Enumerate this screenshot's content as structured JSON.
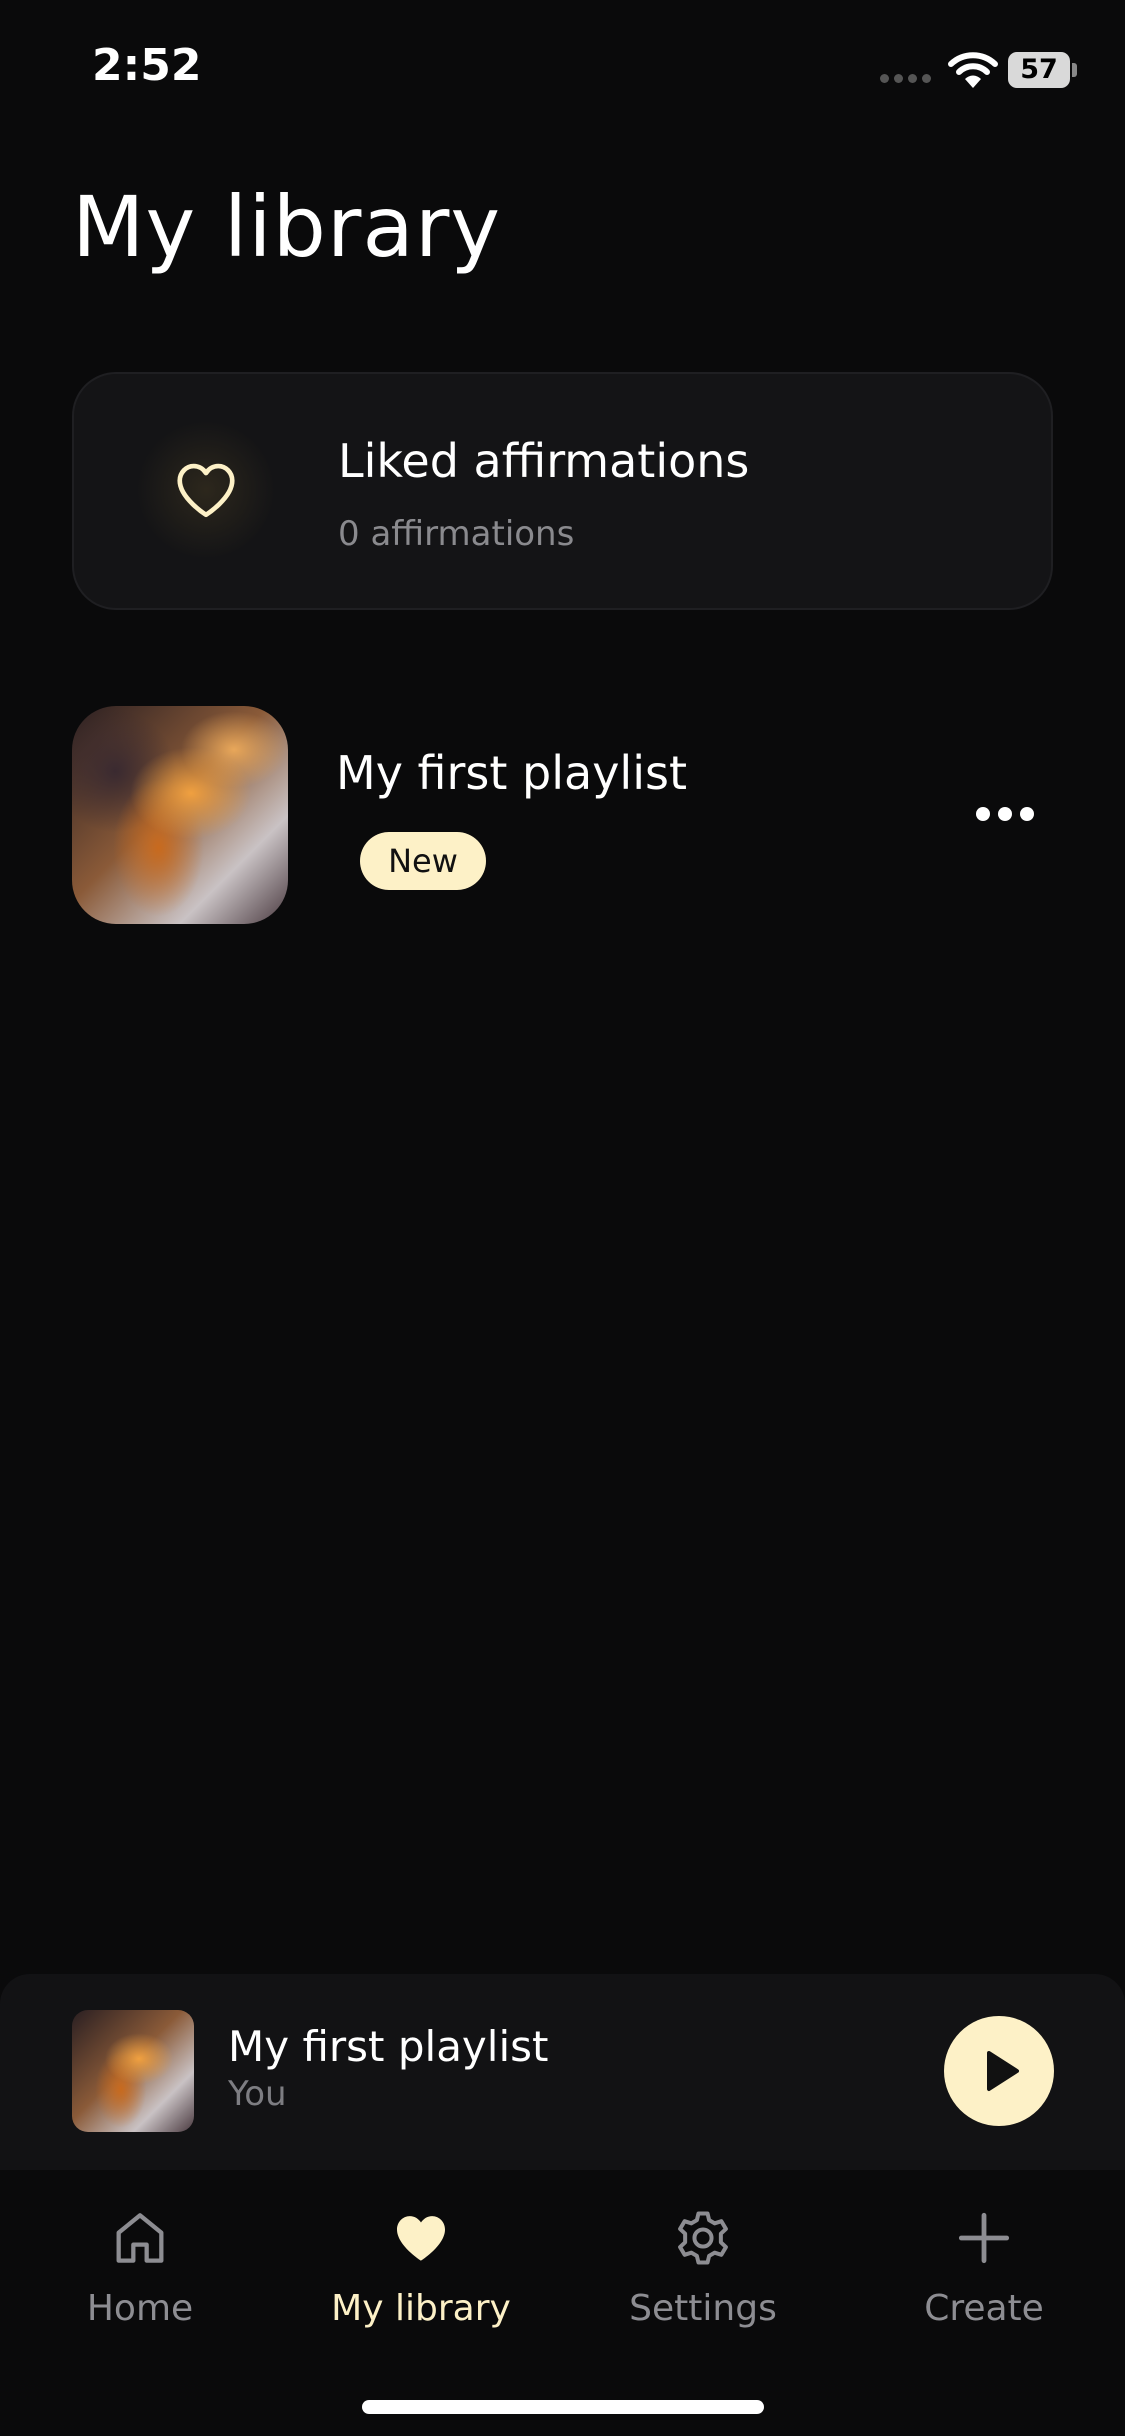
{
  "status_bar": {
    "time": "2:52",
    "battery": "57",
    "icons": [
      "signal-icon",
      "wifi-icon",
      "battery-icon"
    ]
  },
  "page": {
    "title": "My library"
  },
  "liked_card": {
    "title": "Liked affirmations",
    "count": "0 affirmations",
    "icon": "heart-outline-icon"
  },
  "playlists": [
    {
      "title": "My first playlist",
      "badge": "New",
      "menu_icon": "more-horizontal-icon"
    }
  ],
  "mini_player": {
    "title": "My first playlist",
    "subtitle": "You",
    "play_icon": "play-icon"
  },
  "tab_bar": {
    "items": [
      {
        "label": "Home",
        "icon": "home-icon",
        "active": false
      },
      {
        "label": "My library",
        "icon": "heart-icon",
        "active": true
      },
      {
        "label": "Settings",
        "icon": "gear-icon",
        "active": false
      },
      {
        "label": "Create",
        "icon": "plus-icon",
        "active": false
      }
    ]
  },
  "colors": {
    "background": "#0a0a0b",
    "accent": "#fdf1c7",
    "card": "#141416",
    "muted_text": "#8d8d92"
  }
}
